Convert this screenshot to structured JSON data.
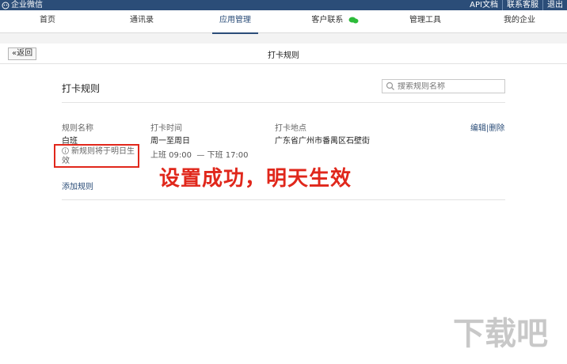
{
  "topbar": {
    "brand": "企业微信",
    "links": [
      "API文档",
      "联系客服",
      "退出"
    ]
  },
  "nav": {
    "items": [
      "首页",
      "通讯录",
      "应用管理",
      "客户联系",
      "管理工具",
      "我的企业"
    ],
    "active_index": 2
  },
  "subheader": {
    "back_label": "«返回",
    "title": "打卡规则"
  },
  "panel": {
    "title": "打卡规则",
    "search_placeholder": "搜索规则名称",
    "columns": [
      "规则名称",
      "打卡时间",
      "打卡地点"
    ],
    "rule": {
      "name": "白班",
      "days": "周一至周日",
      "hours": "上班 09:00  — 下班 17:00",
      "location": "广东省广州市番禺区石壁街",
      "note": "新规则将于明日生效"
    },
    "actions": {
      "edit": "编辑",
      "delete": "删除"
    },
    "add_rule": "添加规则"
  },
  "overlay": {
    "callout": "设置成功，明天生效",
    "watermark": "下载吧"
  },
  "colors": {
    "nav_bar": "#2b4d78",
    "highlight_red": "#e1271b",
    "link_blue": "#2b4d78"
  }
}
